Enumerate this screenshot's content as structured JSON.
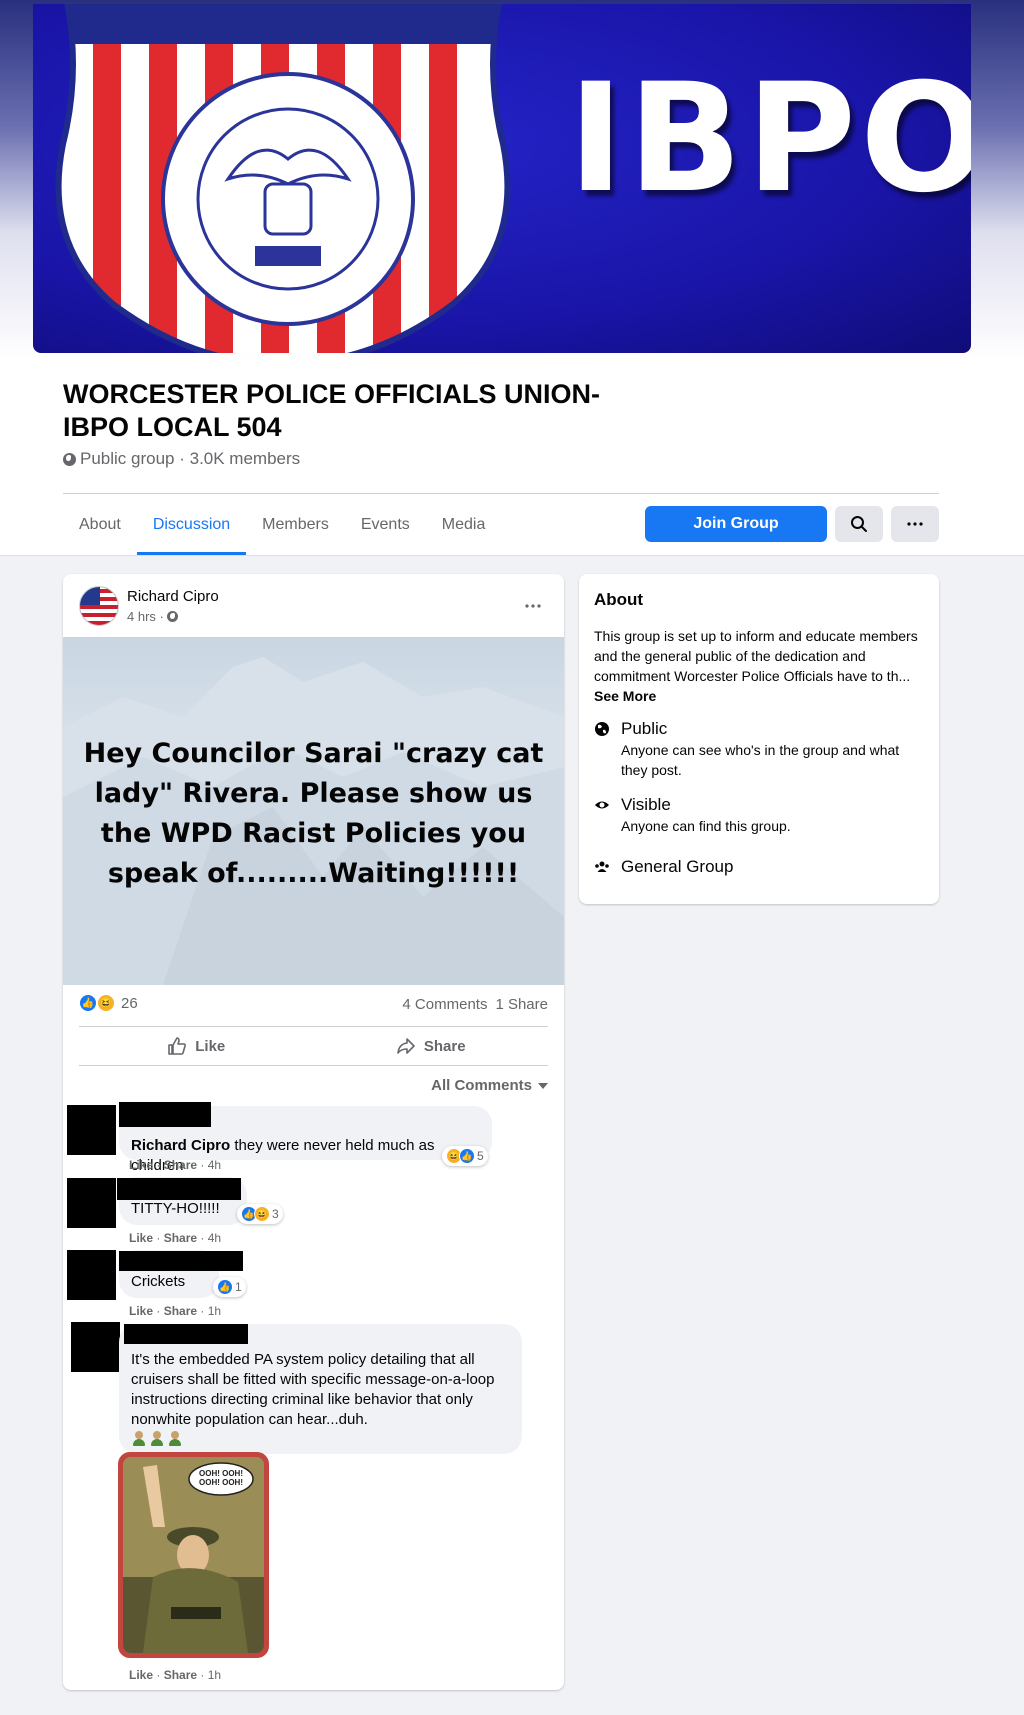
{
  "group": {
    "cover_text": "IBPO",
    "title": "WORCESTER POLICE OFFICIALS UNION- IBPO LOCAL 504",
    "meta": "Public group · 3.0K members"
  },
  "tabs": [
    {
      "label": "About"
    },
    {
      "label": "Discussion",
      "active": true
    },
    {
      "label": "Members"
    },
    {
      "label": "Events"
    },
    {
      "label": "Media"
    }
  ],
  "buttons": {
    "join": "Join Group",
    "search_icon": "search-icon",
    "more_icon": "more-icon"
  },
  "post": {
    "author": "Richard Cipro",
    "time": "4 hrs ·",
    "image_text": "Hey Councilor Sarai \"crazy cat lady\" Rivera. Please show us the WPD Racist Policies you speak of.........Waiting!!!!!!",
    "reaction_count": "26",
    "comments_count": "4 Comments",
    "shares_count": "1 Share",
    "like_label": "Like",
    "share_label": "Share",
    "all_comments_label": "All Comments"
  },
  "comments": [
    {
      "author": "Richard Cipro",
      "text": " they were never held much as children",
      "reaction_count": "5",
      "meta_like": "Like",
      "meta_share": "Share",
      "time": "4h"
    },
    {
      "text": "TITTY-HO!!!!!",
      "reaction_count": "3",
      "meta_like": "Like",
      "meta_share": "Share",
      "time": "4h"
    },
    {
      "text": "Crickets",
      "reaction_count": "1",
      "meta_like": "Like",
      "meta_share": "Share",
      "time": "1h"
    },
    {
      "text": "It's the embedded PA system policy detailing that all cruisers shall be fitted with specific message-on-a-loop instructions directing criminal like behavior that only nonwhite population can hear...duh.",
      "meta_like": "Like",
      "meta_share": "Share",
      "time": "1h",
      "gif_caption": "OOH! OOH! OOH! OOH!"
    }
  ],
  "about": {
    "heading": "About",
    "description": "This group is set up to inform and educate members and the general public of the dedication and commitment Worcester Police Officials have to th...",
    "see_more": "See More",
    "privacy_title": "Public",
    "privacy_desc": "Anyone can see who's in the group and what they post.",
    "visibility_title": "Visible",
    "visibility_desc": "Anyone can find this group.",
    "type_title": "General Group"
  },
  "colors": {
    "accent": "#1877f2",
    "cover_blue": "#1c17b4",
    "badge_red": "#e02a2f"
  }
}
